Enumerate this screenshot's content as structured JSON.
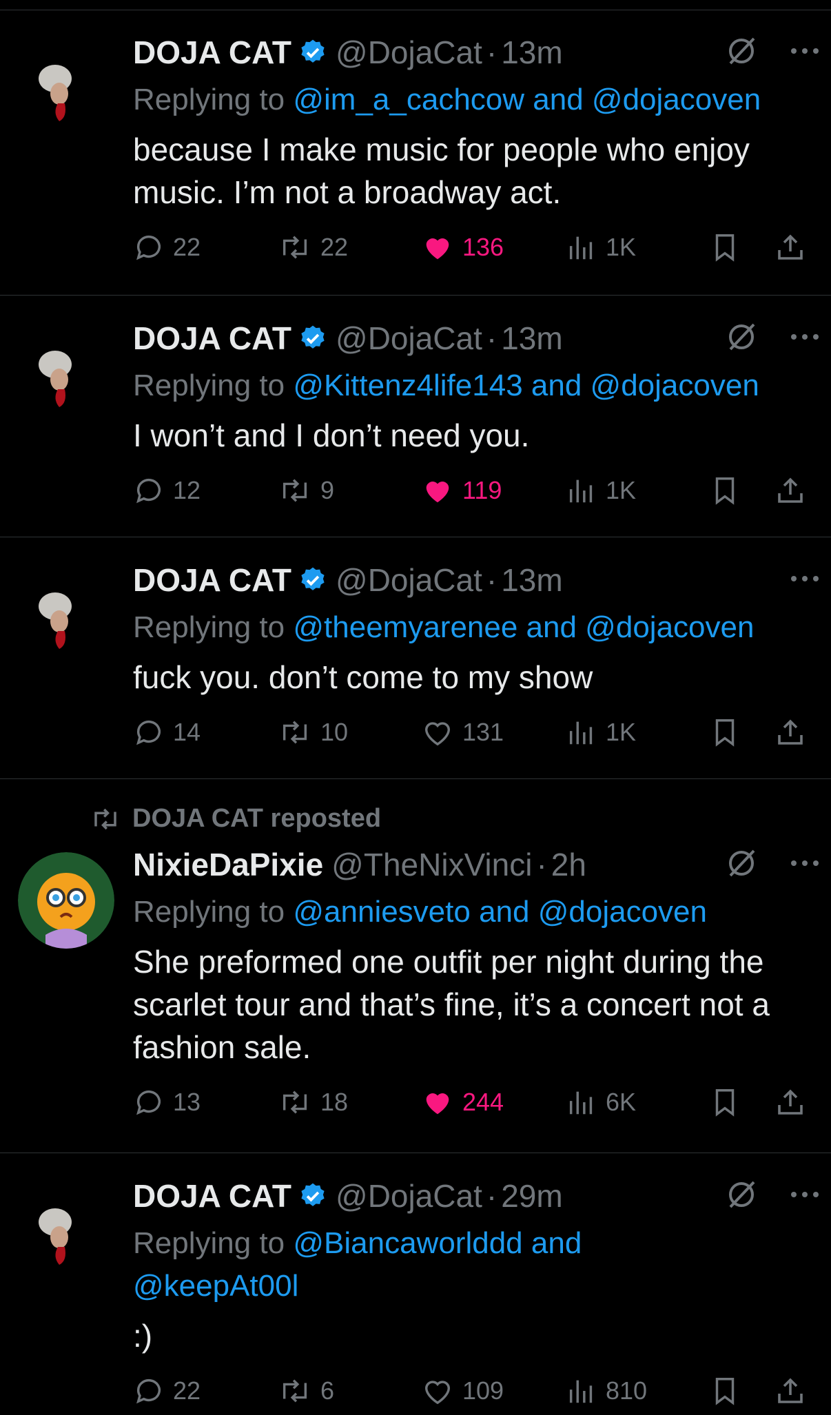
{
  "colors": {
    "background": "#000000",
    "text": "#e7e9ea",
    "muted": "#71767b",
    "link": "#1d9bf0",
    "like": "#f91880",
    "verified": "#1d9bf0",
    "divider": "#2f3336"
  },
  "tweets": [
    {
      "name": "DOJA CAT",
      "verified": true,
      "handle": "@DojaCat",
      "dot": "·",
      "time": "13m",
      "replying_prefix": "Replying to ",
      "mentions": "@im_a_cachcow and @dojacoven",
      "text": "because I make music for people who enjoy music. I’m not a broadway act.",
      "replies": "22",
      "reposts": "22",
      "likes": "136",
      "liked": true,
      "views": "1K",
      "limited_icon": true
    },
    {
      "name": "DOJA CAT",
      "verified": true,
      "handle": "@DojaCat",
      "dot": "·",
      "time": "13m",
      "replying_prefix": "Replying to ",
      "mentions": "@Kittenz4life143 and @dojacoven",
      "text": "I won’t and I don’t need you.",
      "replies": "12",
      "reposts": "9",
      "likes": "119",
      "liked": true,
      "views": "1K",
      "limited_icon": true
    },
    {
      "name": "DOJA CAT",
      "verified": true,
      "handle": "@DojaCat",
      "dot": "·",
      "time": "13m",
      "replying_prefix": "Replying to ",
      "mentions": "@theemyarenee and @dojacoven",
      "text": "fuck you. don’t come to my show",
      "replies": "14",
      "reposts": "10",
      "likes": "131",
      "liked": false,
      "views": "1K",
      "limited_icon": false
    },
    {
      "repost_banner": "DOJA CAT reposted",
      "name": "NixieDaPixie",
      "verified": false,
      "handle": "@TheNixVinci",
      "dot": "·",
      "time": "2h",
      "replying_prefix": "Replying to ",
      "mentions": "@anniesveto and @dojacoven",
      "text": "She preformed one outfit per night during the scarlet tour and that’s fine, it’s a concert not a fashion sale.",
      "replies": "13",
      "reposts": "18",
      "likes": "244",
      "liked": true,
      "views": "6K",
      "limited_icon": true
    },
    {
      "name": "DOJA CAT",
      "verified": true,
      "handle": "@DojaCat",
      "dot": "·",
      "time": "29m",
      "replying_prefix": "Replying to ",
      "mentions": "@Biancaworlddd and @keepAt00l",
      "text": ":)",
      "replies": "22",
      "reposts": "6",
      "likes": "109",
      "liked": false,
      "views": "810",
      "limited_icon": true
    }
  ],
  "icons": [
    "reply-icon",
    "repost-icon",
    "like-icon",
    "views-icon",
    "bookmark-icon",
    "share-icon",
    "more-icon",
    "limited-reply-icon",
    "verified-badge-icon"
  ]
}
